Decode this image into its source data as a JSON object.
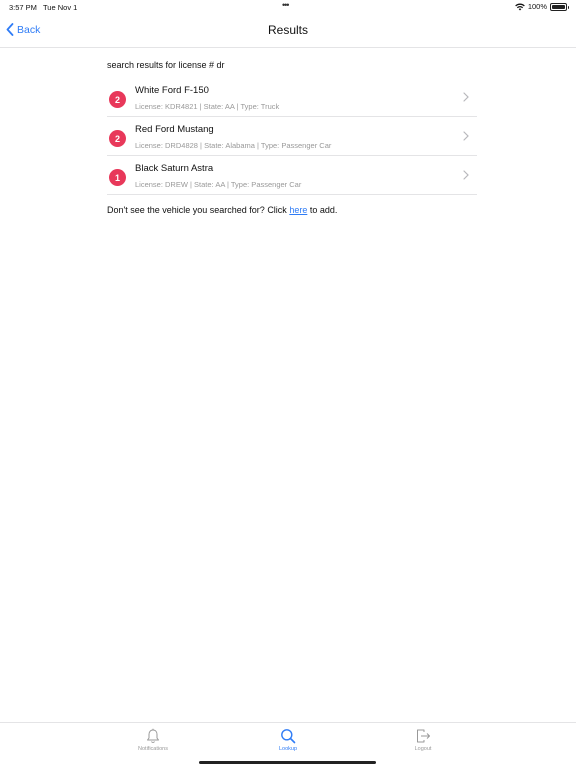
{
  "status_bar": {
    "time": "3:57 PM",
    "date": "Tue Nov 1",
    "dots": "•••",
    "battery": "100%"
  },
  "nav": {
    "back_label": "Back",
    "title": "Results"
  },
  "search": {
    "summary": "search results for license # dr"
  },
  "results": [
    {
      "badge": "2",
      "title": "White Ford F-150",
      "detail": "License: KDR4821 | State: AA | Type: Truck"
    },
    {
      "badge": "2",
      "title": "Red Ford Mustang",
      "detail": "License: DRD4828 | State: Alabama | Type: Passenger Car"
    },
    {
      "badge": "1",
      "title": "Black Saturn Astra",
      "detail": "License: DREW | State: AA | Type: Passenger Car"
    }
  ],
  "add_note": {
    "prefix": "Don't see the vehicle you searched for? Click ",
    "link": "here",
    "suffix": " to add."
  },
  "tabs": [
    {
      "label": "Notifications",
      "icon": "bell-icon"
    },
    {
      "label": "Lookup",
      "icon": "search-icon",
      "active": true
    },
    {
      "label": "Logout",
      "icon": "logout-icon"
    }
  ],
  "colors": {
    "accent": "#2f7cf6",
    "badge": "#e8385a",
    "muted": "#999999"
  }
}
